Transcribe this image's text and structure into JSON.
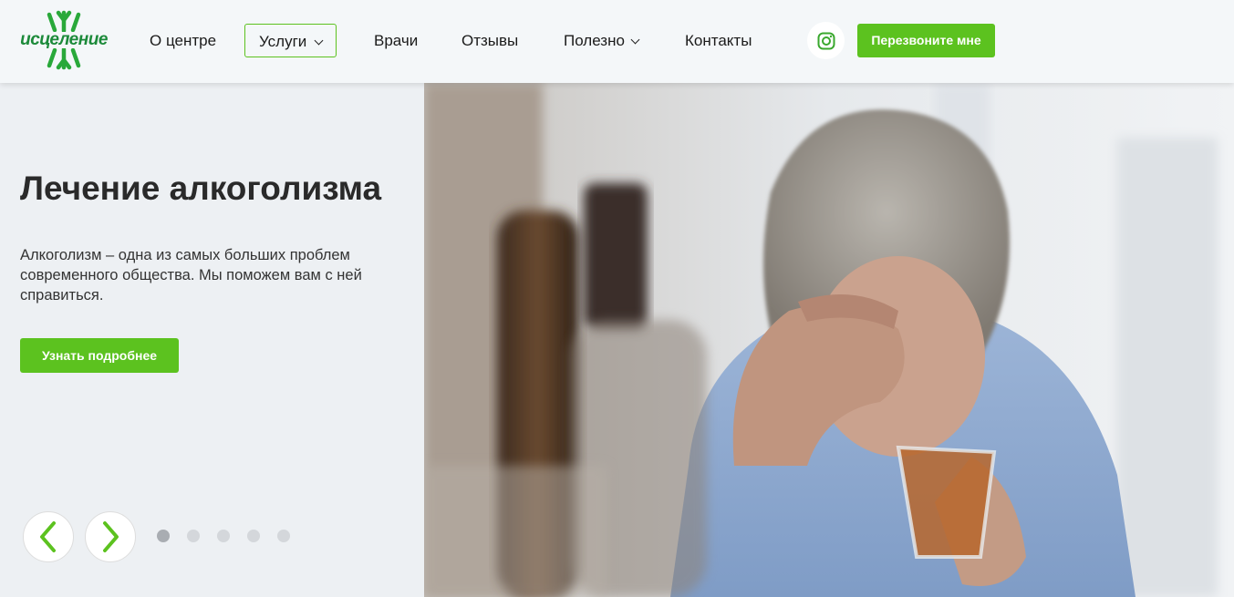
{
  "header": {
    "logo_text": "исцеление",
    "nav": [
      {
        "label": "О центре"
      },
      {
        "label": "Услуги"
      },
      {
        "label": "Врачи"
      },
      {
        "label": "Отзывы"
      },
      {
        "label": "Полезно"
      },
      {
        "label": "Контакты"
      }
    ],
    "callback_label": "Перезвоните мне"
  },
  "hero": {
    "title": "Лечение алкоголизма",
    "text": "Алкоголизм – одна из самых больших проблем современного общества. Мы поможем вам с ней справиться.",
    "button_label": "Узнать подробнее",
    "slides_total": 5,
    "slide_active": 1
  },
  "colors": {
    "accent": "#5cc21f",
    "logo": "#1c8a3a"
  },
  "icons": {
    "social": "instagram-icon",
    "prev": "chevron-left-icon",
    "next": "chevron-right-icon"
  }
}
